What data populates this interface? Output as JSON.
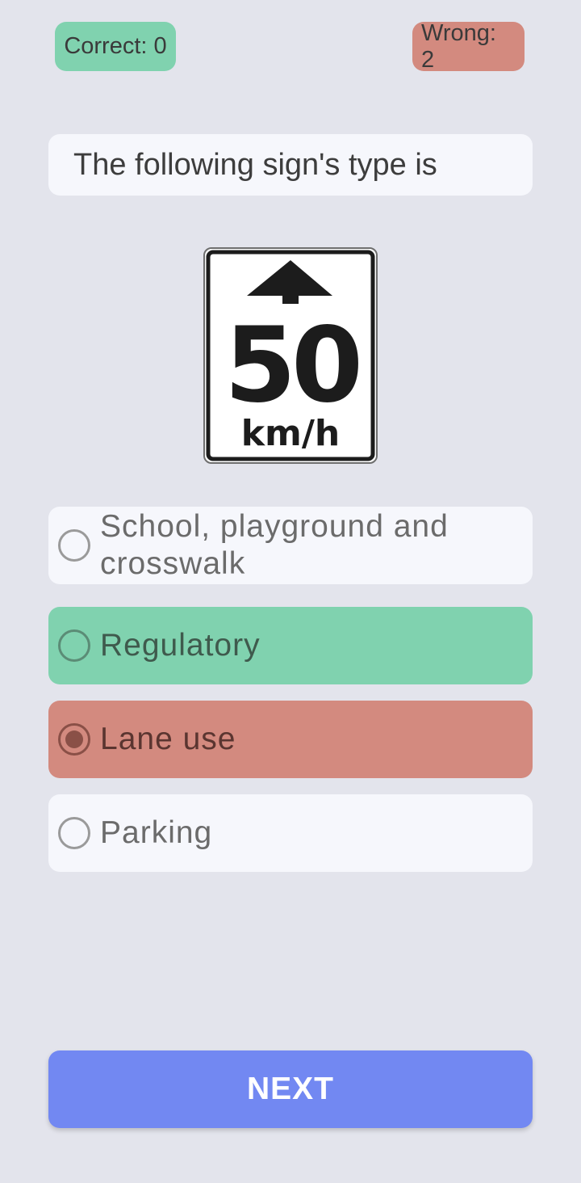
{
  "score": {
    "correct_label": "Correct: 0",
    "wrong_label": "Wrong: 2"
  },
  "question": {
    "text": "The following sign's type is"
  },
  "sign": {
    "speed": "50",
    "unit": "km/h",
    "icon": "arrow-up-icon"
  },
  "options": [
    {
      "label": "School, playground and crosswalk",
      "selected": false,
      "state": "neutral"
    },
    {
      "label": "Regulatory",
      "selected": false,
      "state": "correct"
    },
    {
      "label": "Lane use",
      "selected": true,
      "state": "wrong"
    },
    {
      "label": "Parking",
      "selected": false,
      "state": "neutral"
    }
  ],
  "next_button": {
    "label": "NEXT"
  },
  "colors": {
    "background": "#e3e4ec",
    "correct": "#80d2af",
    "wrong": "#d38a7f",
    "card": "#f6f7fc",
    "primary": "#7288f2"
  }
}
